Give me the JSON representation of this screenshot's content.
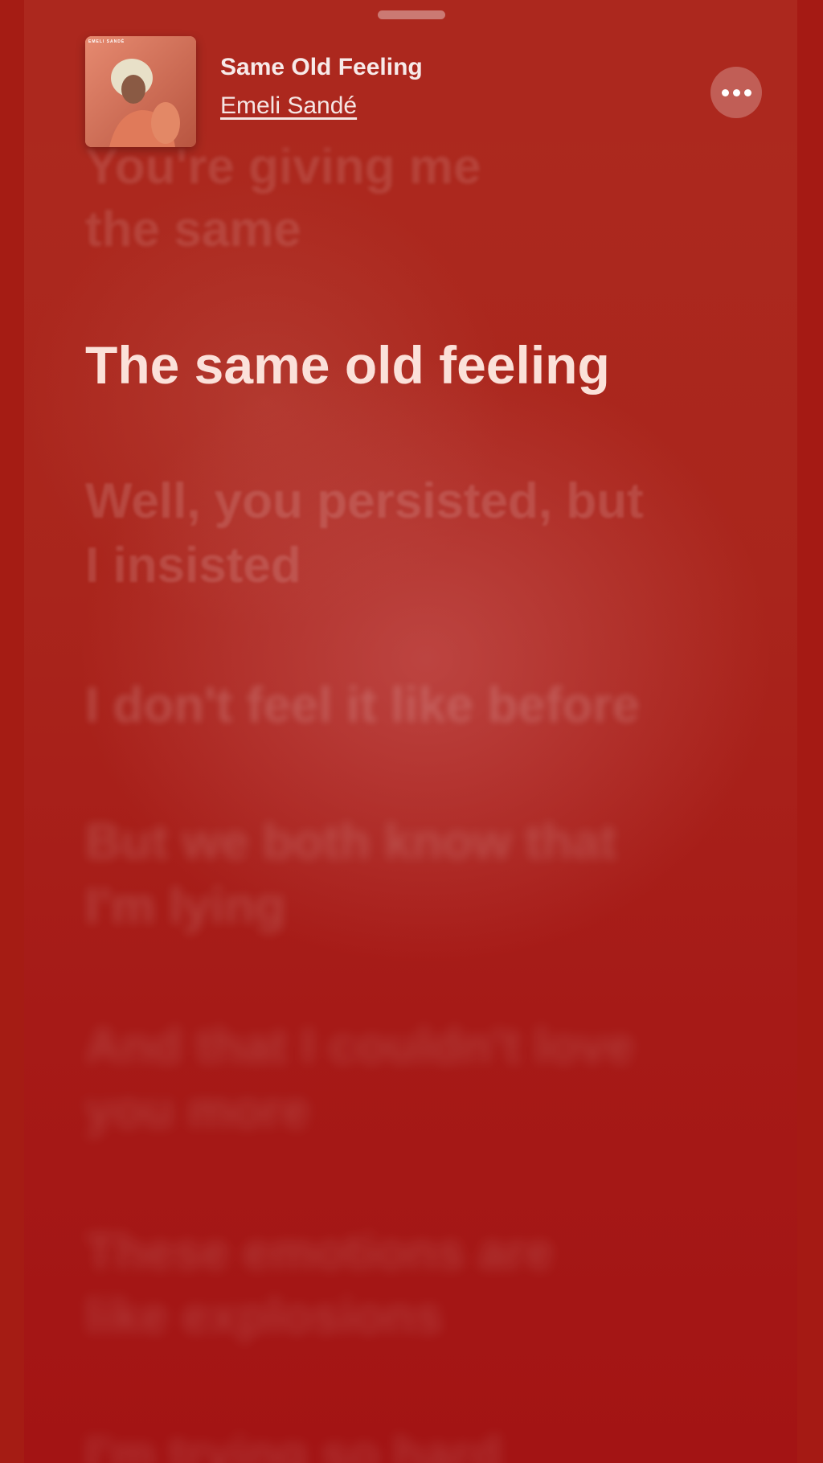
{
  "now_playing": {
    "title": "Same Old Feeling",
    "artist": "Emeli Sandé",
    "album_art_text": "EMELI SANDÉ",
    "more_icon": "ellipsis-icon"
  },
  "lyrics": {
    "above": [
      "You're giving me",
      "the same"
    ],
    "active": "The same old feeling",
    "upcoming": [
      [
        "Well, you persisted, but",
        "I insisted"
      ],
      [
        "I don't feel it like before"
      ],
      [
        "But we both know that",
        "I'm lying"
      ],
      [
        "And that I couldn't love",
        "you more"
      ],
      [
        "These emotions are",
        "like explosions"
      ],
      [
        "I'm trying so hard"
      ]
    ]
  },
  "colors": {
    "background": "#a81a14",
    "accent_text": "#ffebe4"
  }
}
